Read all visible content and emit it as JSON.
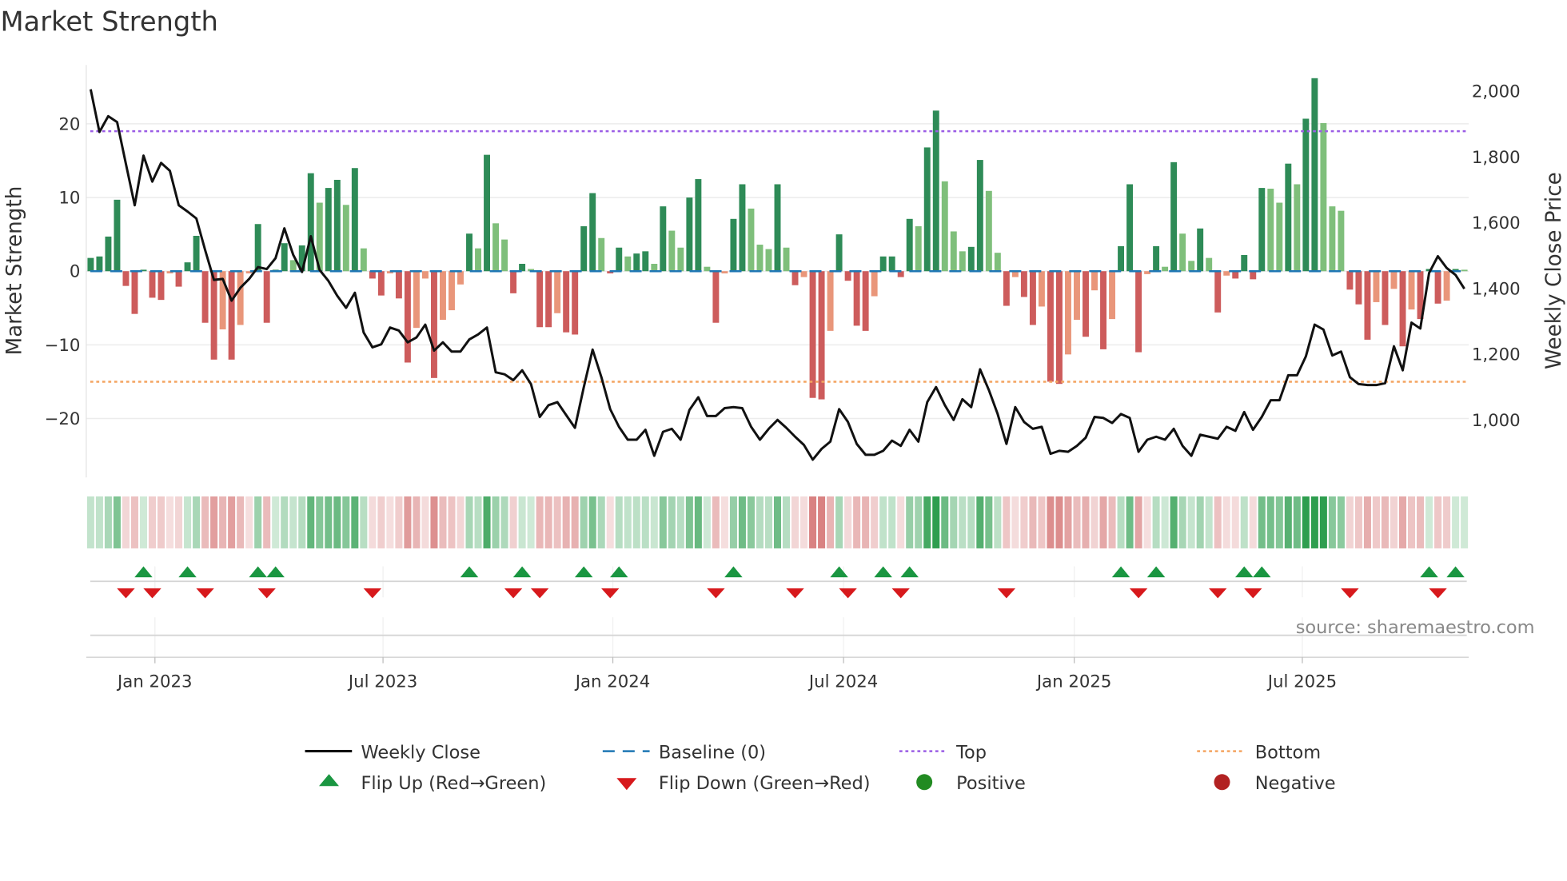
{
  "chart_data": {
    "type": "bar",
    "title": "Market Strength",
    "ylabel": "Market Strength",
    "y2label": "Weekly Close Price",
    "ylim": [
      -28,
      28
    ],
    "y2lim": [
      825,
      2080
    ],
    "xlim": [
      -0.5,
      156.5
    ],
    "yticks": [
      20,
      10,
      0,
      -10,
      -20
    ],
    "yticklabels": [
      "20",
      "10",
      "0",
      "−10",
      "−20"
    ],
    "y2ticks": [
      2000,
      1800,
      1600,
      1400,
      1200,
      1000
    ],
    "y2ticklabels": [
      "2,000",
      "1,800",
      "1,600",
      "1,400",
      "1,200",
      "1,000"
    ],
    "xticks": [
      {
        "week": 7.3,
        "label": "Jan 2023"
      },
      {
        "week": 33.2,
        "label": "Jul 2023"
      },
      {
        "week": 59.3,
        "label": "Jan 2024"
      },
      {
        "week": 85.5,
        "label": "Jul 2024"
      },
      {
        "week": 111.7,
        "label": "Jan 2025"
      },
      {
        "week": 137.6,
        "label": "Jul 2025"
      }
    ],
    "top_level": 19.0,
    "bottom_level": -15.0,
    "baseline": 0,
    "strength": [
      1.8,
      2.0,
      4.7,
      9.7,
      -2.0,
      -5.8,
      0.2,
      -3.6,
      -3.9,
      -0.3,
      -2.1,
      1.2,
      4.8,
      -7.0,
      -12.0,
      -7.9,
      -12.0,
      -7.3,
      -0.3,
      6.4,
      -7.0,
      0.2,
      3.8,
      1.5,
      3.5,
      13.3,
      9.3,
      11.3,
      12.4,
      9.0,
      14.0,
      3.1,
      -1.0,
      -3.3,
      -0.3,
      -3.7,
      -12.4,
      -7.7,
      -1.0,
      -14.5,
      -6.6,
      -5.3,
      -1.8,
      5.1,
      3.1,
      15.8,
      6.5,
      4.3,
      -3.0,
      1.0,
      0.3,
      -7.6,
      -7.6,
      -5.7,
      -8.3,
      -8.6,
      6.1,
      10.6,
      4.5,
      -0.3,
      3.2,
      2.0,
      2.4,
      2.7,
      1.0,
      8.8,
      5.5,
      3.2,
      10.0,
      12.5,
      0.6,
      -7.0,
      -0.3,
      7.1,
      11.8,
      8.5,
      3.6,
      3.0,
      11.8,
      3.2,
      -1.9,
      -0.8,
      -17.2,
      -17.4,
      -8.1,
      5.0,
      -1.3,
      -7.4,
      -8.1,
      -3.4,
      2.0,
      2.0,
      -0.8,
      7.1,
      6.1,
      16.8,
      21.8,
      12.2,
      5.4,
      2.7,
      3.3,
      15.1,
      10.9,
      2.5,
      -4.7,
      -0.8,
      -3.5,
      -7.3,
      -4.8,
      -15.0,
      -15.3,
      -11.3,
      -6.6,
      -8.9,
      -2.6,
      -10.6,
      -6.5,
      3.4,
      11.8,
      -11.0,
      -0.4,
      3.4,
      0.6,
      14.8,
      5.1,
      1.4,
      5.8,
      1.8,
      -5.6,
      -0.6,
      -1.0,
      2.2,
      -1.1,
      11.3,
      11.2,
      9.3,
      14.6,
      11.8,
      20.7,
      26.2,
      20.1,
      8.8,
      8.2,
      -2.5,
      -4.5,
      -9.3,
      -4.2,
      -7.3,
      -2.4,
      -10.2,
      -5.2,
      -6.5,
      0.3,
      -4.4,
      -4.0,
      0.3,
      0.2
    ],
    "weekly_close": [
      2006,
      1876,
      1924,
      1906,
      1779,
      1653,
      1804,
      1725,
      1782,
      1758,
      1653,
      1634,
      1613,
      1517,
      1426,
      1429,
      1363,
      1402,
      1429,
      1465,
      1459,
      1492,
      1583,
      1502,
      1450,
      1559,
      1456,
      1423,
      1378,
      1341,
      1387,
      1266,
      1221,
      1230,
      1281,
      1272,
      1236,
      1251,
      1290,
      1211,
      1236,
      1208,
      1208,
      1245,
      1260,
      1281,
      1145,
      1139,
      1121,
      1151,
      1109,
      1009,
      1045,
      1054,
      1015,
      976,
      1100,
      1214,
      1130,
      1033,
      979,
      940,
      940,
      970,
      891,
      964,
      973,
      940,
      1030,
      1069,
      1012,
      1012,
      1036,
      1039,
      1036,
      979,
      940,
      973,
      1000,
      976,
      949,
      924,
      879,
      912,
      934,
      1033,
      994,
      927,
      894,
      894,
      906,
      937,
      921,
      970,
      934,
      1054,
      1100,
      1045,
      1000,
      1063,
      1039,
      1154,
      1091,
      1018,
      927,
      1039,
      994,
      973,
      979,
      897,
      906,
      903,
      921,
      946,
      1009,
      1006,
      991,
      1018,
      1006,
      903,
      940,
      949,
      940,
      973,
      921,
      891,
      955,
      949,
      943,
      979,
      967,
      1024,
      970,
      1009,
      1060,
      1060,
      1136,
      1136,
      1193,
      1290,
      1275,
      1196,
      1208,
      1130,
      1109,
      1106,
      1106,
      1112,
      1224,
      1151,
      1296,
      1278,
      1447,
      1498,
      1462,
      1441,
      1399
    ],
    "legend": {
      "placement": "bottom",
      "weekly_close": "Weekly Close",
      "baseline": "Baseline (0)",
      "top": "Top",
      "bottom": "Bottom",
      "flip_up": "Flip Up (Red→Green)",
      "flip_down": "Flip Down (Green→Red)",
      "positive": "Positive",
      "negative": "Negative"
    },
    "colors": {
      "pos_strong": "#2e8b57",
      "pos_weak": "#7fbf7b",
      "neg_strong": "#cd5c5c",
      "neg_weak": "#e9967a",
      "close": "#111111",
      "baseline": "#1f77b4",
      "top": "#9b5de5",
      "bottom": "#f4a460",
      "flip_up": "#1a9641",
      "flip_down": "#d7191c",
      "positive": "#228b22",
      "negative": "#b22222"
    }
  },
  "source": "source: sharemaestro.com"
}
